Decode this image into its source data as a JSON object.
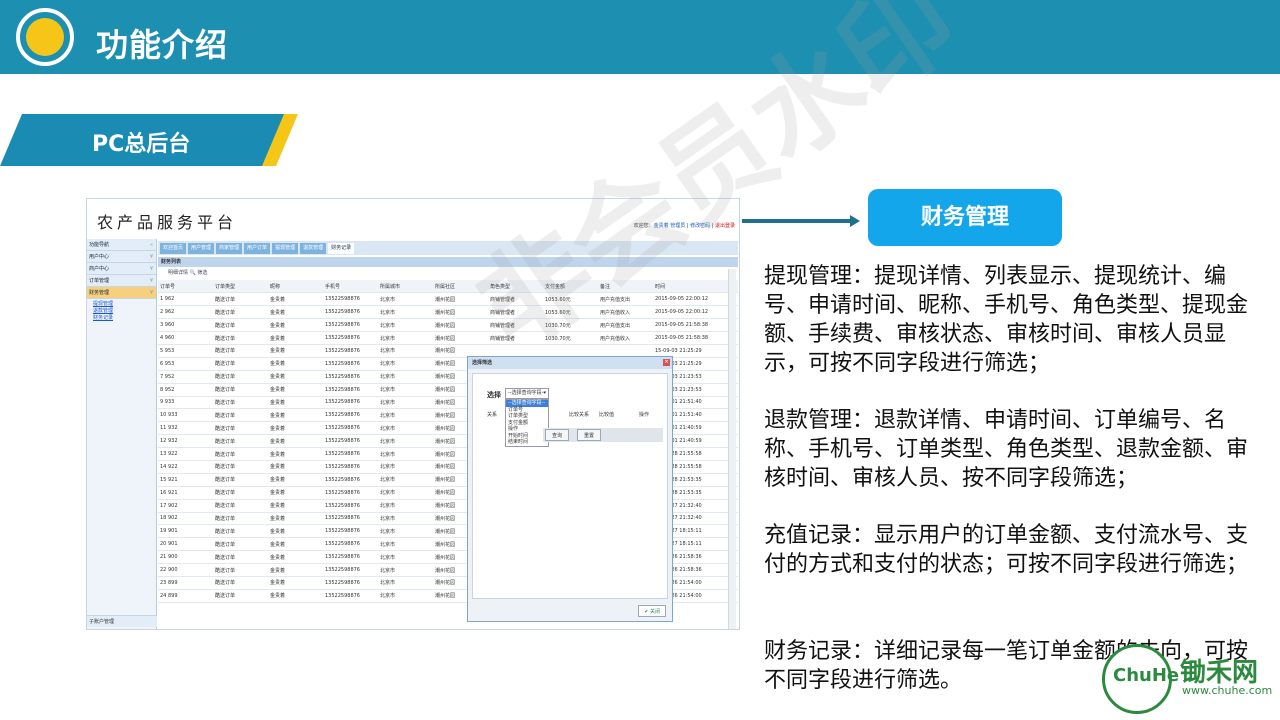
{
  "header": {
    "title": "功能介绍"
  },
  "section": {
    "label": "PC总后台"
  },
  "screenshot": {
    "app_title": "农产品服务平台",
    "welcome": "欢迎您：",
    "user": "金贵着 管理员",
    "change_pwd": "修改密码",
    "logout": "退出登录",
    "sidebar": {
      "items": [
        {
          "label": "功能导航"
        },
        {
          "label": "用户中心"
        },
        {
          "label": "商户中心"
        },
        {
          "label": "订单管理"
        },
        {
          "label": "财务管理"
        }
      ],
      "sub_items": [
        "提现管理",
        "退款管理",
        "财务记录"
      ],
      "bottom": "子账户管理"
    },
    "tabs": [
      "欢迎首页",
      "用户管理",
      "商家管理",
      "用户订单",
      "提现管理",
      "退款管理",
      "财务记录"
    ],
    "panel_title": "财务列表",
    "toolbar": "明细详情  🔍 筛选",
    "columns": [
      "订单号",
      "订单类型",
      "昵称",
      "手机号",
      "所属城市",
      "所属社区",
      "角色类型",
      "支付金额",
      "备注",
      "时间"
    ],
    "rows": [
      [
        "1  962",
        "酷送订单",
        "金贵着",
        "13522598876",
        "北京市",
        "潮州花园",
        "商铺管理者",
        "1053.60元",
        "用户充值支出",
        "2015-09-05 22:00:12"
      ],
      [
        "2  962",
        "酷送订单",
        "金贵着",
        "13522598876",
        "北京市",
        "潮州花园",
        "商铺管理者",
        "1053.60元",
        "用户充值收入",
        "2015-09-05 22:00:12"
      ],
      [
        "3  960",
        "酷送订单",
        "金贵着",
        "13522598876",
        "北京市",
        "潮州花园",
        "商铺管理者",
        "1030.70元",
        "用户充值支出",
        "2015-09-05 21:58:38"
      ],
      [
        "4  960",
        "酷送订单",
        "金贵着",
        "13522598876",
        "北京市",
        "潮州花园",
        "商铺管理者",
        "1030.70元",
        "用户充值收入",
        "2015-09-05 21:58:38"
      ],
      [
        "5  953",
        "酷送订单",
        "金贵着",
        "13522598876",
        "北京市",
        "潮州花园",
        "",
        "",
        "",
        "15-09-03 21:25:29"
      ],
      [
        "6  953",
        "酷送订单",
        "金贵着",
        "13522598876",
        "北京市",
        "潮州花园",
        "",
        "",
        "",
        "15-09-03 21:25:29"
      ],
      [
        "7  952",
        "酷送订单",
        "金贵着",
        "13522598876",
        "北京市",
        "潮州花园",
        "",
        "",
        "",
        "15-09-03 21:23:53"
      ],
      [
        "8  952",
        "酷送订单",
        "金贵着",
        "13522598876",
        "北京市",
        "潮州花园",
        "",
        "",
        "",
        "15-09-03 21:23:53"
      ],
      [
        "9  933",
        "酷送订单",
        "金贵着",
        "13522598876",
        "北京市",
        "潮州花园",
        "",
        "",
        "",
        "15-09-01 21:51:40"
      ],
      [
        "10  933",
        "酷送订单",
        "金贵着",
        "13522598876",
        "北京市",
        "潮州花园",
        "",
        "",
        "",
        "15-09-01 21:51:40"
      ],
      [
        "11  932",
        "酷送订单",
        "金贵着",
        "13522598876",
        "北京市",
        "潮州花园",
        "",
        "",
        "",
        "15-09-01 21:40:59"
      ],
      [
        "12  932",
        "酷送订单",
        "金贵着",
        "13522598876",
        "北京市",
        "潮州花园",
        "",
        "",
        "",
        "15-09-01 21:40:59"
      ],
      [
        "13  922",
        "酷送订单",
        "金贵着",
        "13522598876",
        "北京市",
        "潮州花园",
        "",
        "",
        "",
        "15-08-28 21:55:58"
      ],
      [
        "14  922",
        "酷送订单",
        "金贵着",
        "13522598876",
        "北京市",
        "潮州花园",
        "",
        "",
        "",
        "15-08-28 21:55:58"
      ],
      [
        "15  921",
        "酷送订单",
        "金贵着",
        "13522598876",
        "北京市",
        "潮州花园",
        "",
        "",
        "",
        "15-08-28 21:53:35"
      ],
      [
        "16  921",
        "酷送订单",
        "金贵着",
        "13522598876",
        "北京市",
        "潮州花园",
        "",
        "",
        "",
        "15-08-28 21:53:35"
      ],
      [
        "17  902",
        "酷送订单",
        "金贵着",
        "13522598876",
        "北京市",
        "潮州花园",
        "",
        "",
        "",
        "15-08-27 21:32:40"
      ],
      [
        "18  902",
        "酷送订单",
        "金贵着",
        "13522598876",
        "北京市",
        "潮州花园",
        "",
        "",
        "",
        "15-08-27 21:32:40"
      ],
      [
        "19  901",
        "酷送订单",
        "金贵着",
        "13522598876",
        "北京市",
        "潮州花园",
        "",
        "",
        "",
        "15-08-27 18:15:11"
      ],
      [
        "20  901",
        "酷送订单",
        "金贵着",
        "13522598876",
        "北京市",
        "潮州花园",
        "",
        "",
        "",
        "15-08-27 18:15:11"
      ],
      [
        "21  900",
        "酷送订单",
        "金贵着",
        "13522598876",
        "北京市",
        "潮州花园",
        "",
        "",
        "",
        "15-08-26 21:58:36"
      ],
      [
        "22  900",
        "酷送订单",
        "金贵着",
        "13522598876",
        "北京市",
        "潮州花园",
        "",
        "",
        "",
        "15-08-26 21:58:36"
      ],
      [
        "23  899",
        "酷送订单",
        "金贵着",
        "13522598876",
        "北京市",
        "潮州花园",
        "",
        "",
        "",
        "15-08-26 21:54:00"
      ],
      [
        "24  899",
        "酷送订单",
        "金贵着",
        "13522598876",
        "北京市",
        "潮州花园",
        "",
        "",
        "",
        "15-08-26 21:54:00"
      ]
    ],
    "dialog": {
      "title": "选择筛选",
      "select_label": "选择",
      "select_value": "--选择查询字段--",
      "options": [
        "--选择查询字段--",
        "订单号",
        "订单类型",
        "支付金额",
        "操作",
        "开始时间",
        "结束时间"
      ],
      "row_labels": [
        "关系",
        "比较关系",
        "比较值",
        "操作"
      ],
      "query_btn": "查询",
      "reset_btn": "重置",
      "close_btn": "关闭"
    }
  },
  "callout": {
    "label": "财务管理"
  },
  "descriptions": [
    "提现管理：提现详情、列表显示、提现统计、编号、申请时间、昵称、手机号、角色类型、提现金额、手续费、审核状态、审核时间、审核人员显示，可按不同字段进行筛选；",
    "退款管理：退款详情、申请时间、订单编号、名称、手机号、订单类型、角色类型、退款金额、审核时间、审核人员、按不同字段筛选；",
    "充值记录：显示用户的订单金额、支付流水号、支付的方式和支付的状态；可按不同字段进行筛选；",
    "财务记录：详细记录每一笔订单金额的去向，可按不同字段进行筛选。"
  ],
  "watermark": "非会员水印",
  "brand": {
    "logo_text": "ChuHe",
    "name": "锄禾网",
    "url": "www.chuhe.com"
  },
  "colors": {
    "header": "#1d8fb0",
    "accent": "#f5c518",
    "callout": "#14a6ea",
    "brand": "#2b8a3e"
  }
}
